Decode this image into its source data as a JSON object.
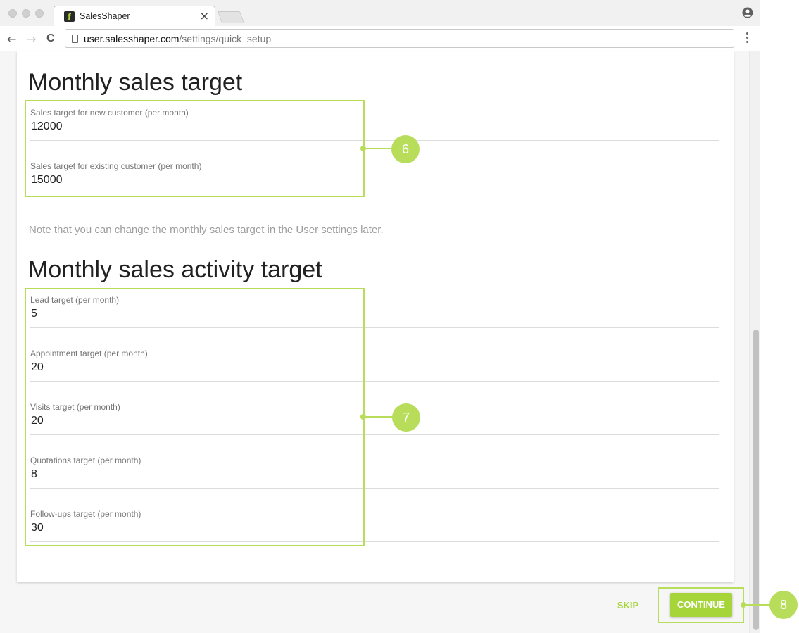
{
  "browser": {
    "tab_title": "SalesShaper",
    "tab_close": "×",
    "favicon_glyph": "ƒ",
    "url_host": "user.salesshaper.com",
    "url_path": "/settings/quick_setup",
    "back": "←",
    "forward": "→",
    "reload": "C"
  },
  "sales_target": {
    "title": "Monthly sales target",
    "fields": [
      {
        "label": "Sales target for new customer (per month)",
        "value": "12000"
      },
      {
        "label": "Sales target for existing customer (per month)",
        "value": "15000"
      }
    ],
    "note": "Note that you can change the monthly sales target in the User settings later."
  },
  "activity_target": {
    "title": "Monthly sales activity target",
    "fields": [
      {
        "label": "Lead target (per month)",
        "value": "5"
      },
      {
        "label": "Appointment target (per month)",
        "value": "20"
      },
      {
        "label": "Visits target (per month)",
        "value": "20"
      },
      {
        "label": "Quotations target (per month)",
        "value": "8"
      },
      {
        "label": "Follow-ups target (per month)",
        "value": "30"
      }
    ]
  },
  "callouts": {
    "one": "6",
    "two": "7",
    "three": "8"
  },
  "actions": {
    "skip_label": "SKIP",
    "continue_label": "CONTINUE"
  },
  "colors": {
    "accent": "#a6d53a",
    "callout": "#b7dd5b"
  }
}
